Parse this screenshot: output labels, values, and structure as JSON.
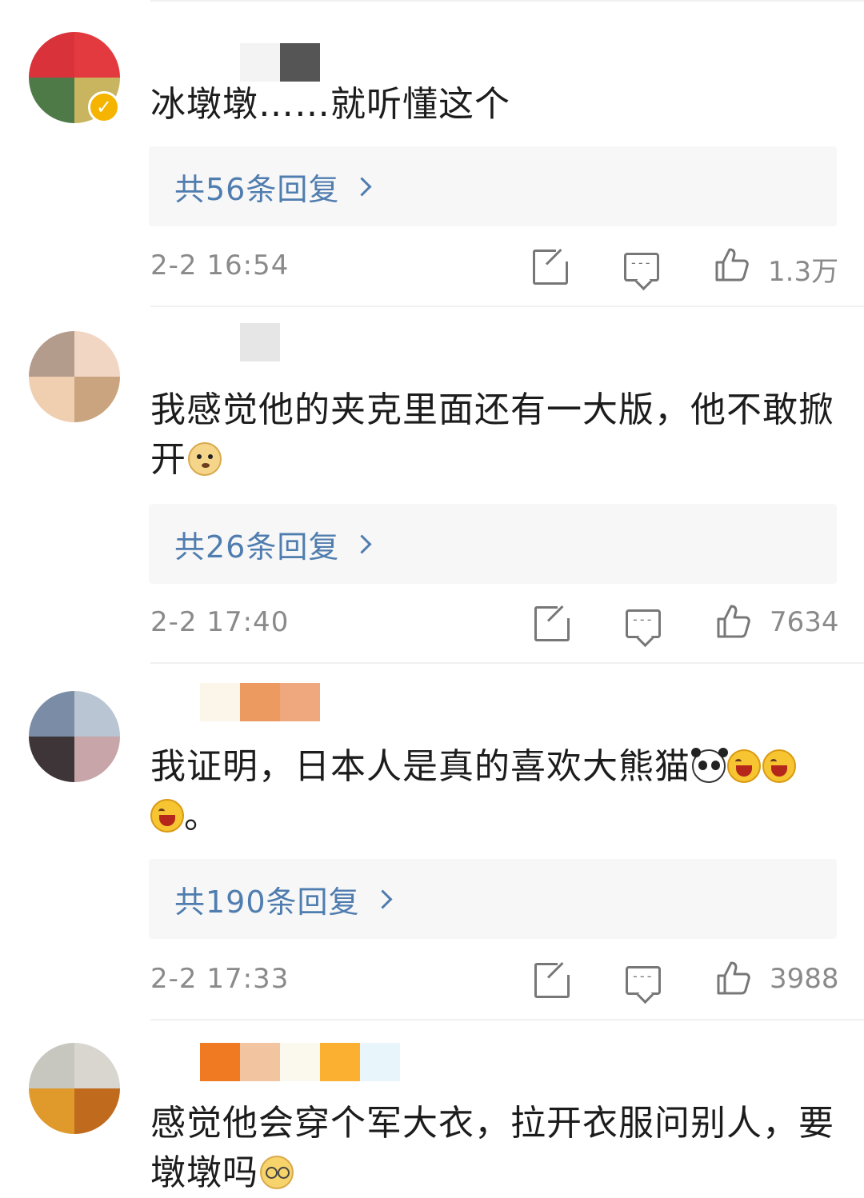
{
  "comments": [
    {
      "text": "冰墩墩……就听懂这个",
      "emojis": [],
      "verified_badge": "✓",
      "replies_label": "共56条回复",
      "time": "2-2 16:54",
      "likes": "1.3万",
      "avatar_colors": [
        "#d9323a",
        "#e23a3f",
        "#4e7a48",
        "#c9b460"
      ],
      "name_blur_colors": [
        "#ffffff",
        "#f3f3f3",
        "#555555"
      ]
    },
    {
      "text": "我感觉他的夹克里面还有一大版，他不敢掀开",
      "emojis": [
        "doge-icon"
      ],
      "replies_label": "共26条回复",
      "time": "2-2 17:40",
      "likes": "7634",
      "avatar_colors": [
        "#b49c8c",
        "#f1d6c4",
        "#f0ceb0",
        "#c9a47e"
      ],
      "name_blur_colors": [
        "#ffffff",
        "#e6e6e6"
      ]
    },
    {
      "text": "我证明，日本人是真的喜欢大熊猫",
      "text_tail": "。",
      "emojis": [
        "panda-icon",
        "laugh-icon",
        "laugh-icon",
        "laugh-icon"
      ],
      "replies_label": "共190条回复",
      "time": "2-2 17:33",
      "likes": "3988",
      "avatar_colors": [
        "#7b8da6",
        "#b9c5d2",
        "#3d3538",
        "#c7a5a8"
      ],
      "name_blur_colors": [
        "#fbf5ea",
        "#ec9a5f",
        "#efa77d"
      ]
    },
    {
      "text": "感觉他会穿个军大衣，拉开衣服问别人，要墩墩吗",
      "emojis": [
        "glasses-face-icon"
      ],
      "avatar_colors": [
        "#c7c7c0",
        "#d9d6d0",
        "#e09a2b",
        "#c06a1d"
      ],
      "name_blur_colors": [
        "#f07a22",
        "#f2c4a0",
        "#fbf8ee",
        "#fbb031",
        "#e8f6fb"
      ]
    }
  ]
}
